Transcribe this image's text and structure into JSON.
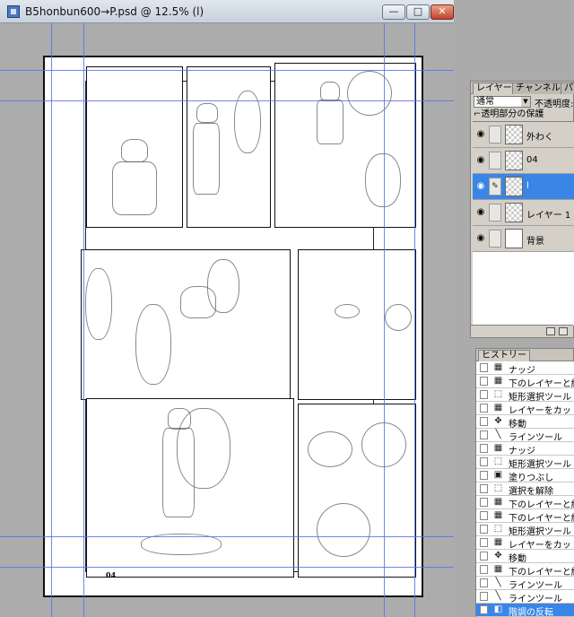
{
  "window": {
    "title": "B5honbun600→P.psd @ 12.5% (l)",
    "minimize": "—",
    "maximize": "□",
    "close": "✕"
  },
  "page": {
    "page_number": "04"
  },
  "layers_panel": {
    "tabs": [
      "レイヤー",
      "チャンネル",
      "パ"
    ],
    "blend_mode": "通常",
    "opacity_label": "不透明度:",
    "lock_label": "透明部分の保護",
    "layers": [
      {
        "name": "外わく",
        "thumb": "transparent",
        "selected": false
      },
      {
        "name": "04",
        "thumb": "transparent",
        "selected": false
      },
      {
        "name": "l",
        "thumb": "transparent",
        "selected": true
      },
      {
        "name": "レイヤー 1",
        "thumb": "transparent",
        "selected": false
      },
      {
        "name": "背景",
        "thumb": "white",
        "selected": false
      }
    ]
  },
  "history_panel": {
    "tab": "ヒストリー",
    "items": [
      {
        "label": "ナッジ",
        "icon": "nudge-icon"
      },
      {
        "label": "下のレイヤーと結合",
        "icon": "merge-icon"
      },
      {
        "label": "矩形選択ツール",
        "icon": "marquee-icon"
      },
      {
        "label": "レイヤーをカット",
        "icon": "cut-layer-icon"
      },
      {
        "label": "移動",
        "icon": "move-icon"
      },
      {
        "label": "ラインツール",
        "icon": "line-icon"
      },
      {
        "label": "ナッジ",
        "icon": "nudge-icon"
      },
      {
        "label": "矩形選択ツール",
        "icon": "marquee-icon"
      },
      {
        "label": "塗りつぶし",
        "icon": "fill-icon"
      },
      {
        "label": "選択を解除",
        "icon": "deselect-icon"
      },
      {
        "label": "下のレイヤーと結合",
        "icon": "merge-icon"
      },
      {
        "label": "下のレイヤーと結合",
        "icon": "merge-icon"
      },
      {
        "label": "矩形選択ツール",
        "icon": "marquee-icon"
      },
      {
        "label": "レイヤーをカット",
        "icon": "cut-layer-icon"
      },
      {
        "label": "移動",
        "icon": "move-icon"
      },
      {
        "label": "下のレイヤーと結合",
        "icon": "merge-icon"
      },
      {
        "label": "ラインツール",
        "icon": "line-icon"
      },
      {
        "label": "ラインツール",
        "icon": "line-icon"
      },
      {
        "label": "階調の反転",
        "icon": "invert-icon"
      }
    ]
  }
}
